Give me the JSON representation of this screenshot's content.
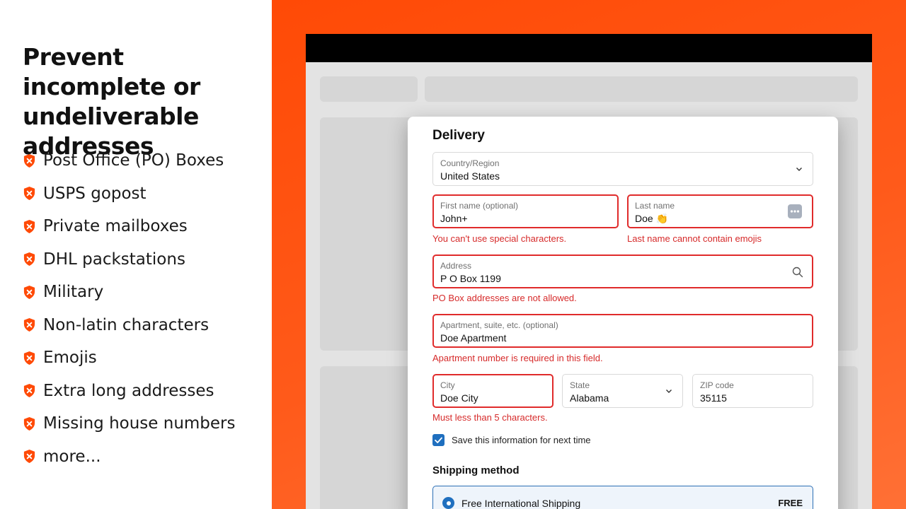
{
  "left": {
    "headline": "Prevent incomplete or undeliverable addresses",
    "features": [
      "Post Office (PO) Boxes",
      "USPS gopost",
      "Private mailboxes",
      "DHL packstations",
      "Military",
      "Non-latin characters",
      "Emojis",
      "Extra long addresses",
      "Missing house numbers",
      "more..."
    ],
    "icon": "shield-x-icon"
  },
  "colors": {
    "accent": "#ff4a06",
    "error": "#e02b2b",
    "primary": "#1f6fbf"
  },
  "form": {
    "title": "Delivery",
    "country": {
      "label": "Country/Region",
      "value": "United States"
    },
    "first_name": {
      "label": "First name (optional)",
      "value": "John+",
      "error": "You can't use special characters."
    },
    "last_name": {
      "label": "Last name",
      "value": "Doe 👏",
      "error": "Last name cannot contain emojis"
    },
    "address": {
      "label": "Address",
      "value": "P O Box 1199",
      "error": "PO Box addresses are not allowed."
    },
    "apartment": {
      "label": "Apartment, suite, etc. (optional)",
      "value": "Doe Apartment",
      "error": "Apartment number is required in this field."
    },
    "city": {
      "label": "City",
      "value": "Doe City",
      "error": "Must less than 5 characters."
    },
    "state": {
      "label": "State",
      "value": "Alabama"
    },
    "zip": {
      "label": "ZIP code",
      "value": "35115"
    },
    "save_info": {
      "label": "Save this information for next time",
      "checked": true
    },
    "shipping": {
      "title": "Shipping method",
      "option": {
        "name": "Free International Shipping",
        "price": "FREE",
        "selected": true
      }
    }
  }
}
